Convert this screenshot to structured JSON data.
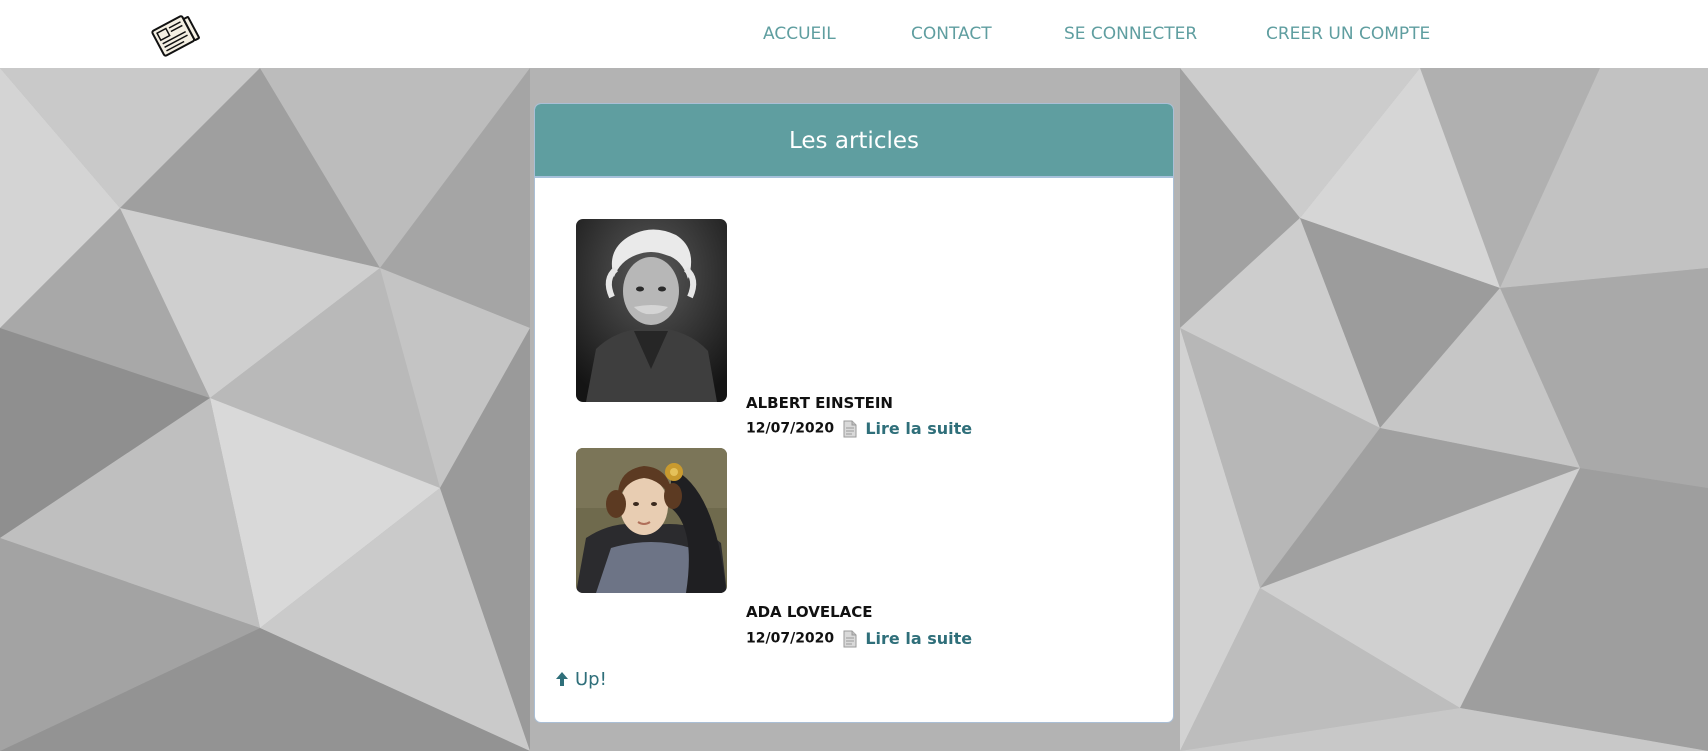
{
  "nav": {
    "logo_icon": "newspaper-icon",
    "items": [
      {
        "label": "ACCUEIL"
      },
      {
        "label": "CONTACT"
      },
      {
        "label": "SE CONNECTER"
      },
      {
        "label": "CREER UN COMPTE"
      }
    ]
  },
  "articles_panel": {
    "title": "Les articles",
    "items": [
      {
        "name": "ALBERT EINSTEIN",
        "date": "12/07/2020",
        "link_label": "Lire la suite",
        "icon": "document-icon",
        "image": "portrait-photo"
      },
      {
        "name": "ADA LOVELACE",
        "date": "12/07/2020",
        "link_label": "Lire la suite",
        "icon": "document-icon",
        "image": "portrait-painting"
      }
    ],
    "up_label": "Up!",
    "up_icon": "up-arrow-icon"
  },
  "colors": {
    "accent": "#5f9ea0",
    "link": "#2f6f7a",
    "header_border": "#a6c1db"
  }
}
